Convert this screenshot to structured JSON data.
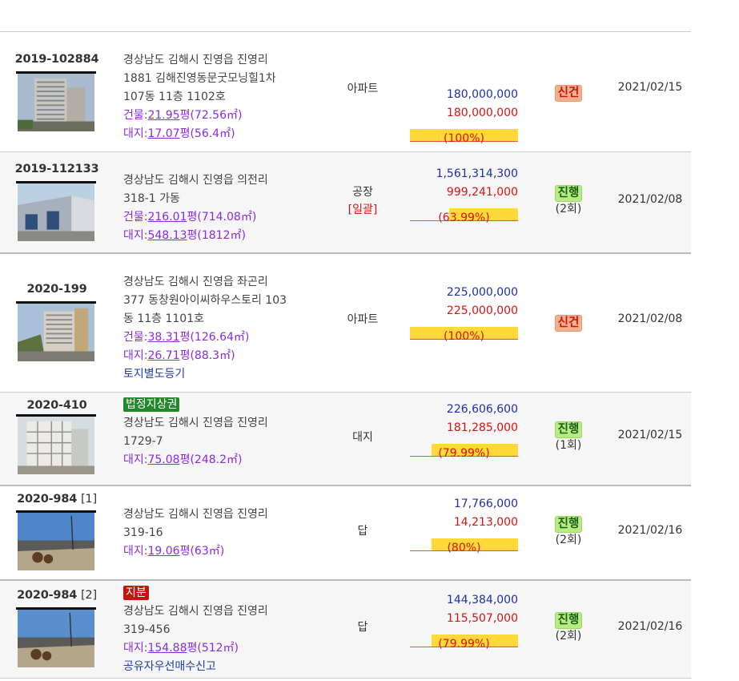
{
  "colors": {
    "accent_yellow": "#ffd83a",
    "red": "#dd1111",
    "blue": "#1f2faa",
    "purple": "#8a2be2",
    "badge_green": "#22882b",
    "badge_red": "#c0180c",
    "status_new_bg": "#f5b08a",
    "status_prog_bg": "#b8ec83"
  },
  "rows": [
    {
      "case_no": "2019-102884",
      "case_sub": "",
      "address": [
        "경상남도 김해시 진영읍 진영리",
        "1881 김해진영동문굿모닝힐1차",
        "107동 11층 1102호"
      ],
      "building_prefix": "건물:",
      "building_area": "21.95",
      "building_unit": "평(72.56㎡)",
      "land_prefix": "대지:",
      "land_area": "17.07",
      "land_unit": "평(56.4㎡)",
      "use": "아파트",
      "appraisal": "180,000,000",
      "min_bid": "180,000,000",
      "ratio": "(100%)",
      "ratio_value": 100,
      "status": "신건",
      "status_count": "",
      "date": "2021/02/15",
      "thumb_icon": "apartment-photo-icon"
    },
    {
      "case_no": "2019-112133",
      "case_sub": "",
      "address": [
        "경상남도 김해시 진영읍 의전리",
        "318-1 가동"
      ],
      "building_prefix": "건물:",
      "building_area": "216.01",
      "building_unit": "평(714.08㎡)",
      "land_prefix": "대지:",
      "land_area": "548.13",
      "land_unit": "평(1812㎡)",
      "use": "공장",
      "use_extra": "[일괄]",
      "appraisal": "1,561,314,300",
      "min_bid": "999,241,000",
      "ratio": "(63.99%)",
      "ratio_value": 63.99,
      "status": "진행",
      "status_count": "(2회)",
      "date": "2021/02/08",
      "thumb_icon": "factory-photo-icon"
    },
    {
      "case_no": "2020-199",
      "case_sub": "",
      "address": [
        "경상남도 김해시 진영읍 좌곤리",
        "377 동창원아이씨하우스토리 103",
        "동 11층 1101호"
      ],
      "building_prefix": "건물:",
      "building_area": "38.31",
      "building_unit": "평(126.64㎡)",
      "land_prefix": "대지:",
      "land_area": "26.71",
      "land_unit": "평(88.3㎡)",
      "note": "토지별도등기",
      "use": "아파트",
      "appraisal": "225,000,000",
      "min_bid": "225,000,000",
      "ratio": "(100%)",
      "ratio_value": 100,
      "status": "신건",
      "status_count": "",
      "date": "2021/02/08",
      "thumb_icon": "apartment-photo-icon"
    },
    {
      "case_no": "2020-410",
      "case_sub": "",
      "badge": "법정지상권",
      "address": [
        "경상남도 김해시 진영읍 진영리",
        "1729-7"
      ],
      "land_prefix": "대지:",
      "land_area": "75.08",
      "land_unit": "평(248.2㎡)",
      "use": "대지",
      "appraisal": "226,606,600",
      "min_bid": "181,285,000",
      "ratio": "(79.99%)",
      "ratio_value": 79.99,
      "status": "진행",
      "status_count": "(1회)",
      "date": "2021/02/15",
      "thumb_icon": "building-photo-icon"
    },
    {
      "case_no": "2020-984",
      "case_sub": "[1]",
      "address": [
        "경상남도 김해시 진영읍 진영리",
        "319-16"
      ],
      "land_prefix": "대지:",
      "land_area": "19.06",
      "land_unit": "평(63㎡)",
      "use": "답",
      "appraisal": "17,766,000",
      "min_bid": "14,213,000",
      "ratio": "(80%)",
      "ratio_value": 80,
      "status": "진행",
      "status_count": "(2회)",
      "date": "2021/02/16",
      "thumb_icon": "road-photo-icon"
    },
    {
      "case_no": "2020-984",
      "case_sub": "[2]",
      "badge": "지분",
      "address": [
        "경상남도 김해시 진영읍 진영리",
        "319-456"
      ],
      "land_prefix": "대지:",
      "land_area": "154.88",
      "land_unit": "평(512㎡)",
      "note": "공유자우선매수신고",
      "use": "답",
      "appraisal": "144,384,000",
      "min_bid": "115,507,000",
      "ratio": "(79.99%)",
      "ratio_value": 79.99,
      "status": "진행",
      "status_count": "(2회)",
      "date": "2021/02/16",
      "thumb_icon": "road-photo-icon"
    }
  ]
}
